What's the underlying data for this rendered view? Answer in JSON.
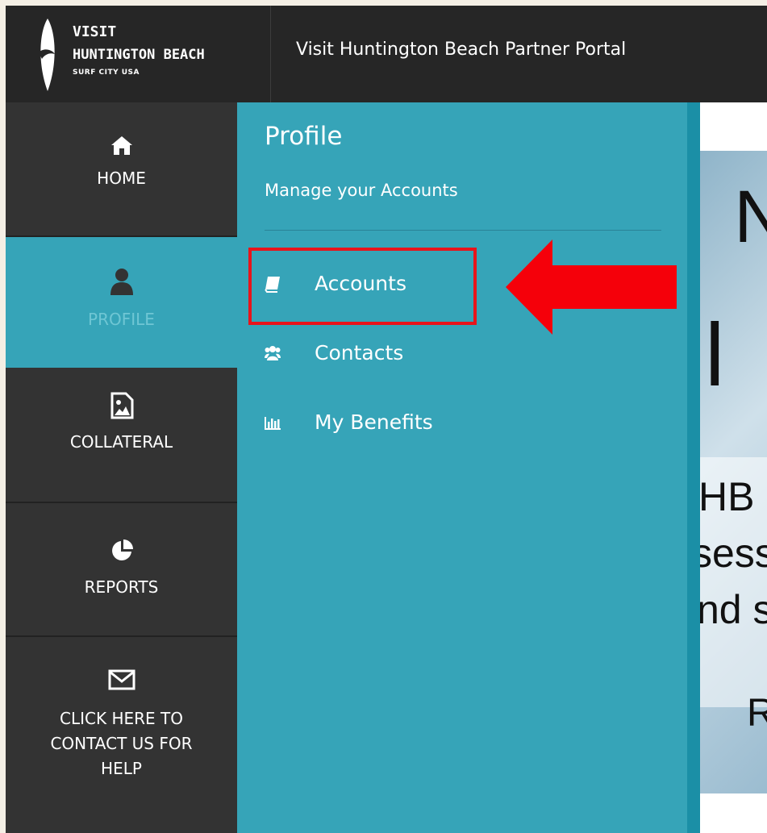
{
  "header": {
    "logo_line1": "VISIT",
    "logo_line2": "HUNTINGTON BEACH",
    "logo_line3": "SURF CITY USA",
    "portal_title": "Visit Huntington Beach Partner Portal"
  },
  "sidebar": {
    "items": [
      {
        "label": "HOME",
        "icon": "home-icon"
      },
      {
        "label": "PROFILE",
        "icon": "user-icon",
        "active": true
      },
      {
        "label": "COLLATERAL",
        "icon": "image-file-icon"
      },
      {
        "label": "REPORTS",
        "icon": "pie-chart-icon"
      },
      {
        "label_lines": [
          "CLICK HERE TO",
          "CONTACT US FOR",
          "HELP"
        ],
        "icon": "envelope-icon"
      }
    ]
  },
  "panel": {
    "title": "Profile",
    "subtitle": "Manage your Accounts",
    "menu": [
      {
        "label": "Accounts",
        "icon": "book-icon"
      },
      {
        "label": "Contacts",
        "icon": "users-icon"
      },
      {
        "label": "My Benefits",
        "icon": "bar-chart-icon"
      }
    ]
  },
  "banner": {
    "fragments": [
      "N",
      "l",
      "HB is",
      "sess",
      "nd s",
      "R"
    ]
  },
  "colors": {
    "topbar": "#262626",
    "sidebar": "#333333",
    "panel": "#36a4b8",
    "highlight": "#e8141b"
  }
}
